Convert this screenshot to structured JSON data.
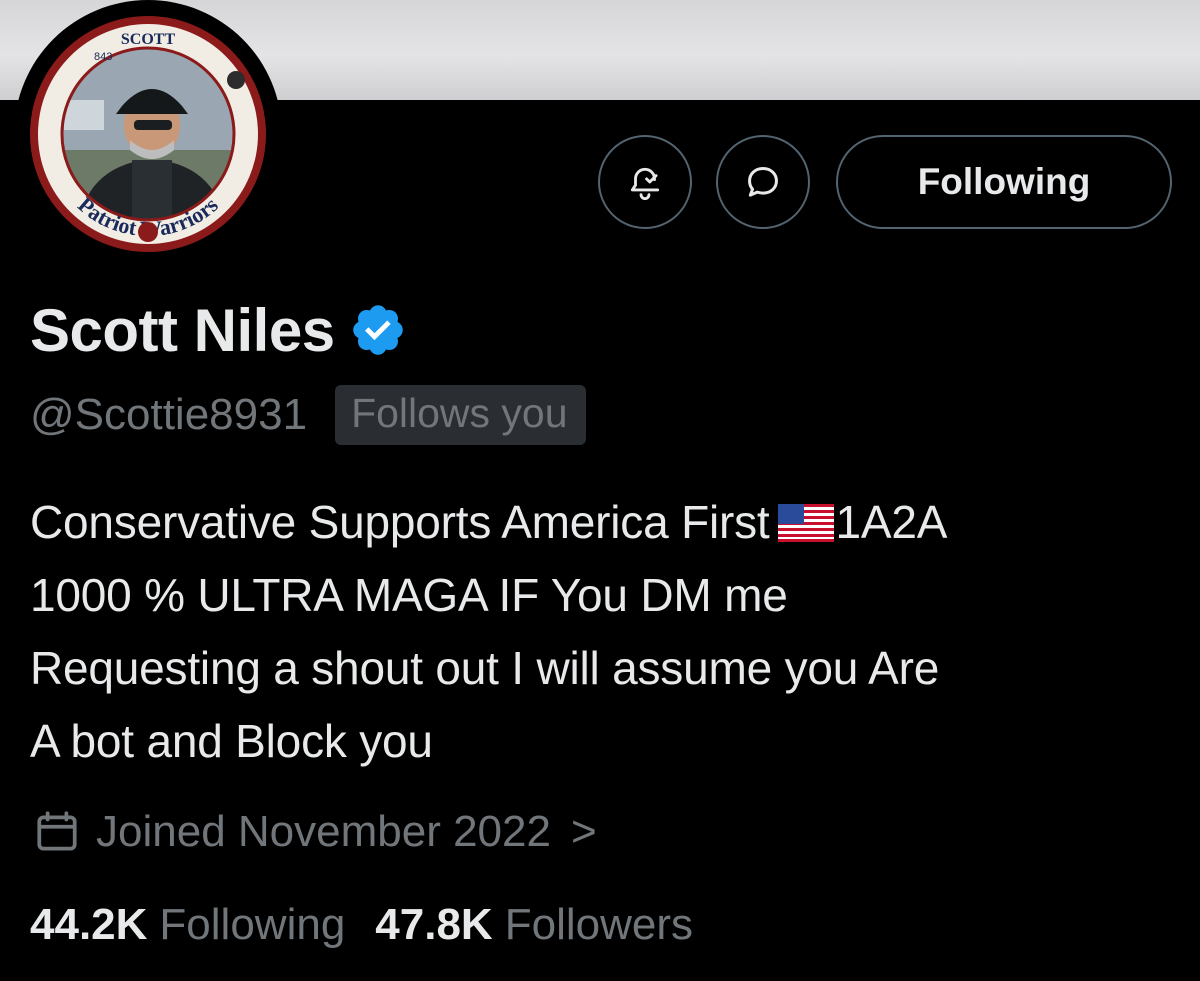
{
  "profile": {
    "display_name": "Scott Niles",
    "handle": "@Scottie8931",
    "follows_you": "Follows you",
    "bio_lines": [
      "Conservative Supports America First",
      "1A2A",
      "1000 % ULTRA MAGA IF You DM me",
      "Requesting a shout out I will assume you Are",
      "A bot and Block you"
    ],
    "joined": "Joined November 2022",
    "joined_chevron": ">",
    "avatar_text": {
      "top": "SCOTT",
      "number": "843",
      "ring": "Patriot Warriors"
    }
  },
  "actions": {
    "following_label": "Following",
    "notify_icon": "bell-check-icon",
    "message_icon": "message-bubble-icon"
  },
  "stats": {
    "following_count": "44.2K",
    "following_label": "Following",
    "followers_count": "47.8K",
    "followers_label": "Followers"
  },
  "colors": {
    "background": "#000000",
    "text_primary": "#e7e9ea",
    "text_secondary": "#71767b",
    "verified_blue": "#1d9bf0",
    "button_border": "#536471"
  }
}
